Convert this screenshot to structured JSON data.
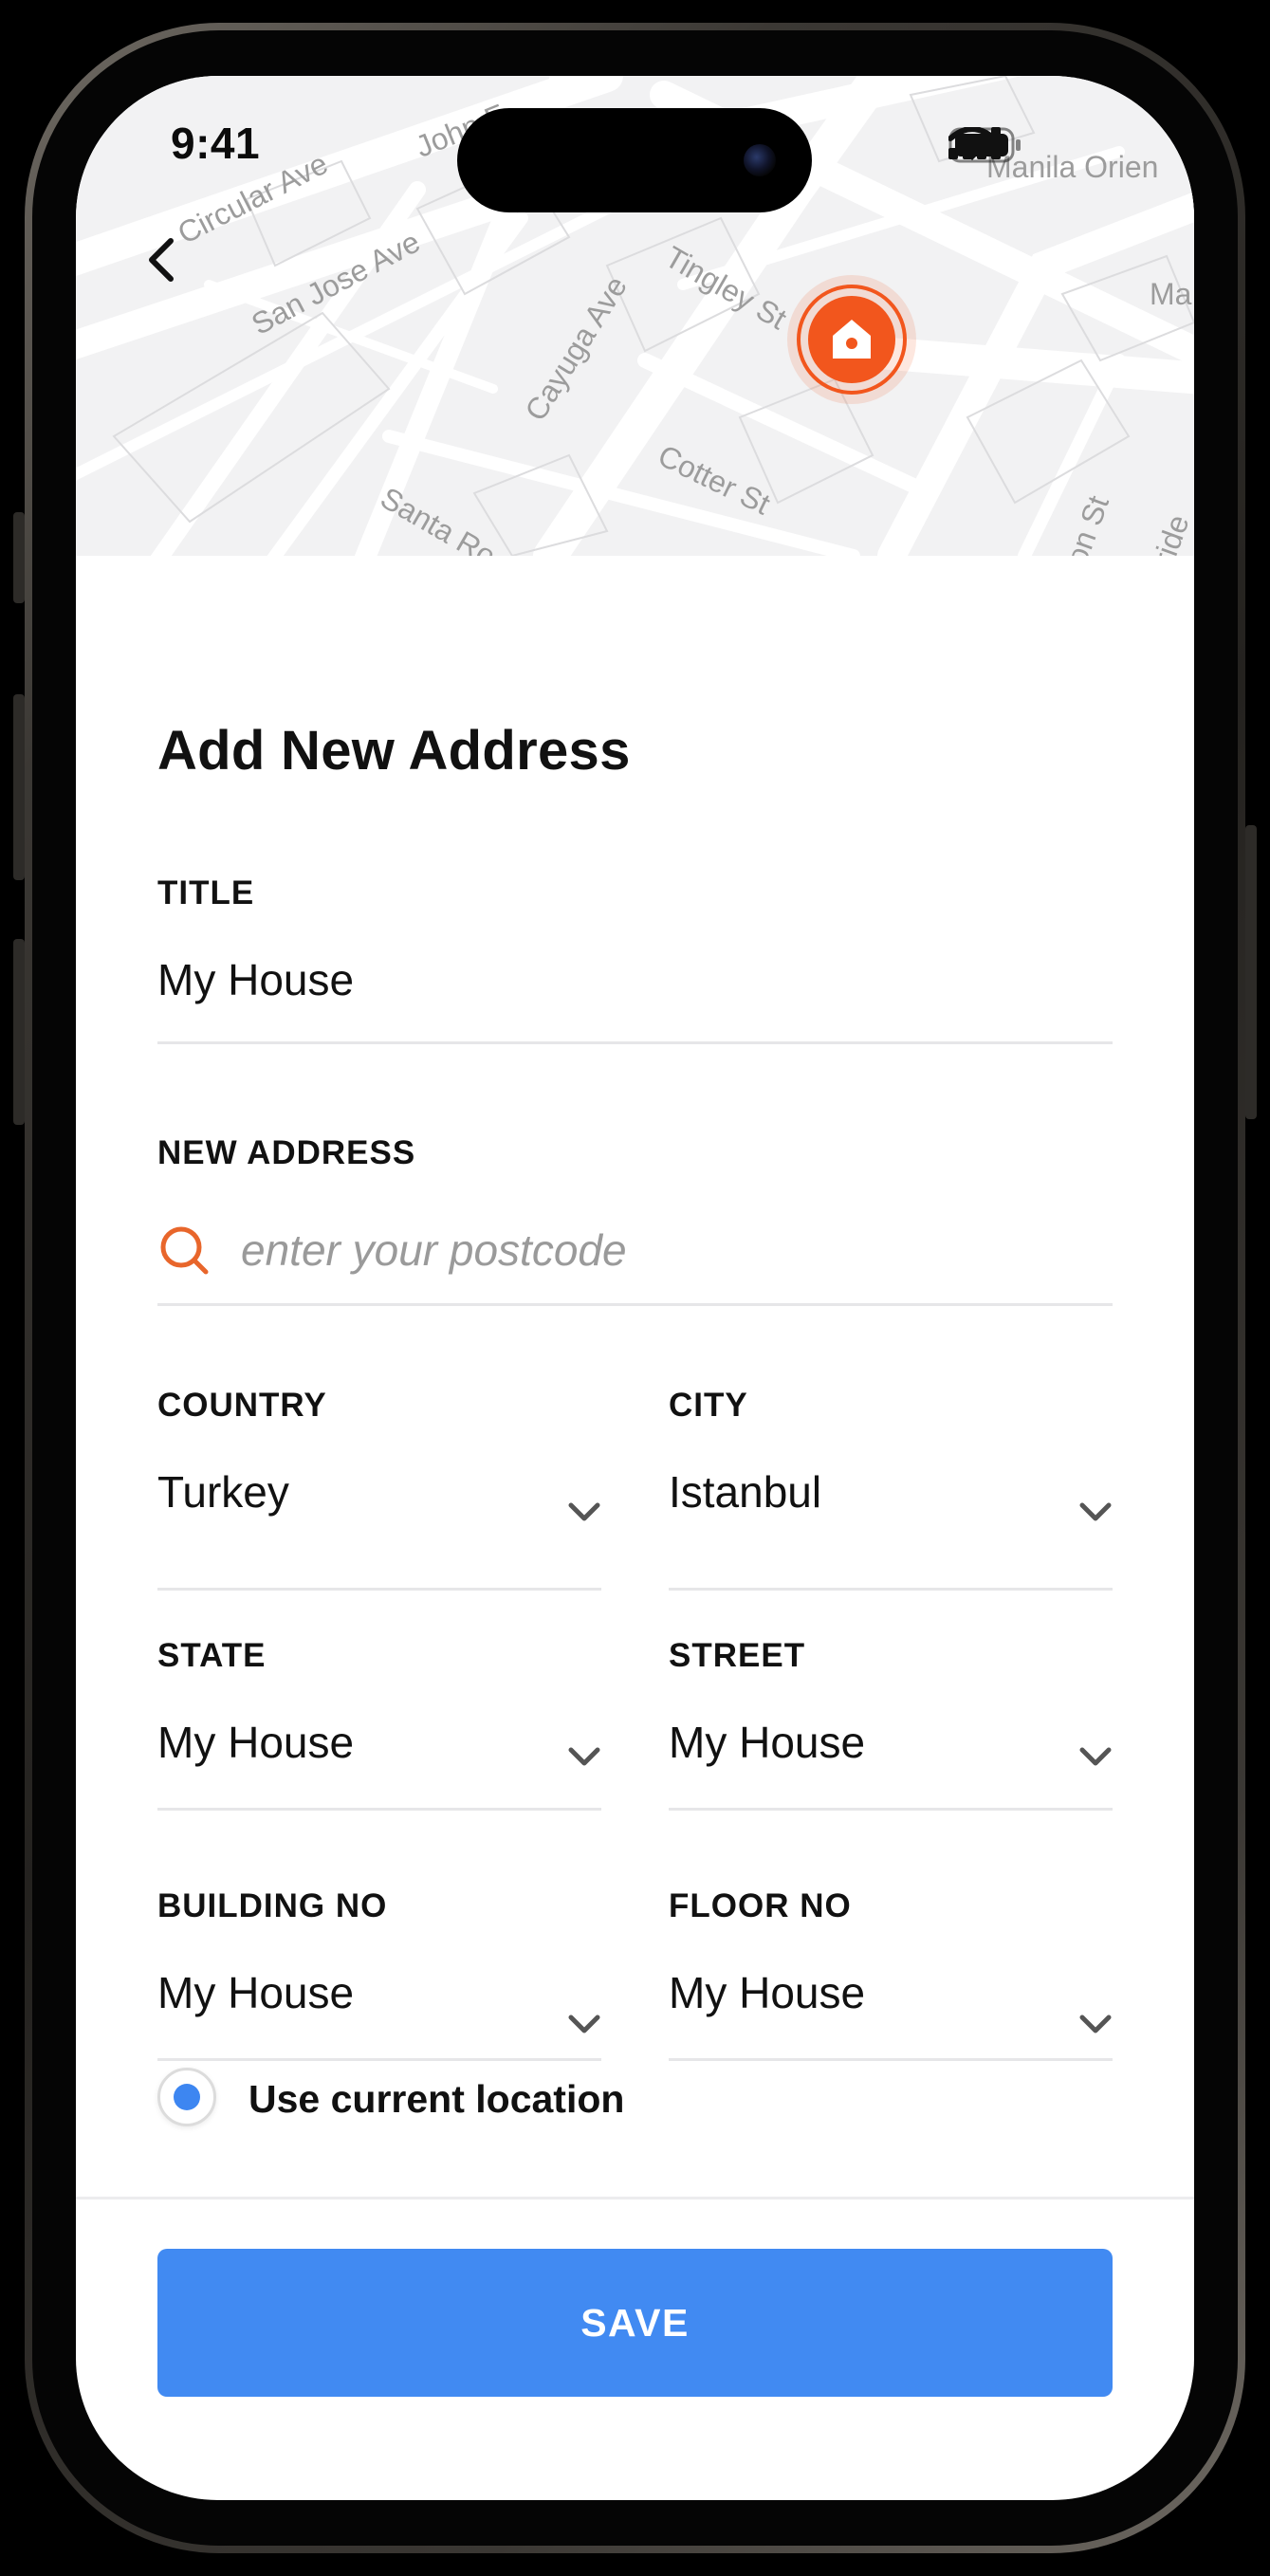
{
  "status_bar": {
    "time": "9:41",
    "icons": [
      "cellular-signal-icon",
      "wifi-icon",
      "battery-icon"
    ]
  },
  "map": {
    "streets": [
      "Circular Ave",
      "John F",
      "San Jose Ave",
      "Tingley St",
      "Cayuga Ave",
      "Cotter St",
      "Santa Rosa",
      "Manila Orien",
      "Ma",
      "on St",
      "ride"
    ],
    "pin_icon": "home-icon",
    "pin_color": "#f2561d"
  },
  "header": {
    "back_icon": "chevron-left-icon",
    "title": "Add New Address"
  },
  "form": {
    "title_field": {
      "label": "TITLE",
      "value": "My House"
    },
    "address_field": {
      "label": "NEW ADDRESS",
      "placeholder": "enter your postcode",
      "icon": "search-icon"
    },
    "country": {
      "label": "COUNTRY",
      "value": "Turkey"
    },
    "city": {
      "label": "CITY",
      "value": "Istanbul"
    },
    "state": {
      "label": "STATE",
      "value": "My House"
    },
    "street": {
      "label": "STREET",
      "value": "My House"
    },
    "building_no": {
      "label": "BUILDING NO",
      "value": "My House"
    },
    "floor_no": {
      "label": "FLOOR NO",
      "value": "My House"
    },
    "current_location": {
      "label": "Use current location",
      "selected": true
    }
  },
  "actions": {
    "save_label": "SAVE"
  },
  "colors": {
    "accent": "#418af2",
    "pin": "#f2561d",
    "search_icon": "#e8662b",
    "divider": "#e6e6e8"
  }
}
